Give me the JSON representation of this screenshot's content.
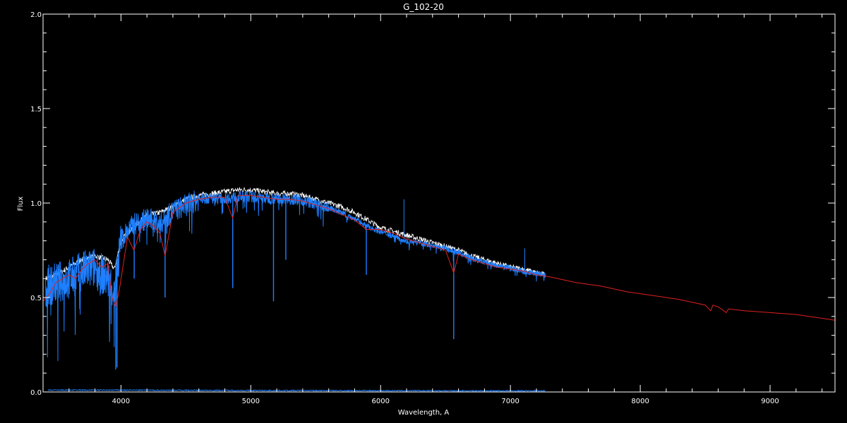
{
  "chart_data": {
    "type": "line",
    "title": "G_102-20",
    "xlabel": "Wavelength, A",
    "ylabel": "Flux",
    "xlim": [
      3400,
      9500
    ],
    "ylim": [
      0.0,
      2.0
    ],
    "x_ticks": [
      4000,
      5000,
      6000,
      7000,
      8000,
      9000
    ],
    "x_tick_labels": [
      "4000",
      "5000",
      "6000",
      "7000",
      "8000",
      "9000"
    ],
    "y_ticks": [
      0.0,
      0.5,
      1.0,
      1.5,
      2.0
    ],
    "y_tick_labels": [
      "0.0",
      "0.5",
      "1.0",
      "1.5",
      "2.0"
    ],
    "grid": false,
    "colors": {
      "background": "#000000",
      "axes": "#ffffff",
      "observed": "#1e7fff",
      "reference": "#ffffff",
      "model": "#e02020",
      "error": "#1e7fff"
    },
    "series": [
      {
        "key": "reference",
        "x": [
          3420,
          3500,
          3600,
          3700,
          3800,
          3900,
          3950,
          4000,
          4100,
          4200,
          4300,
          4400,
          4500,
          4600,
          4700,
          4800,
          4900,
          5000,
          5100,
          5200,
          5300,
          5400,
          5500,
          5600,
          5700,
          5800,
          5900,
          6000,
          6100,
          6200,
          6300,
          6400,
          6500,
          6600,
          6700,
          6800,
          6900,
          7000,
          7100,
          7200,
          7270
        ],
        "y": [
          0.6,
          0.62,
          0.66,
          0.7,
          0.72,
          0.7,
          0.65,
          0.8,
          0.88,
          0.93,
          0.95,
          0.98,
          1.02,
          1.04,
          1.05,
          1.06,
          1.07,
          1.07,
          1.06,
          1.05,
          1.05,
          1.04,
          1.02,
          1.0,
          0.98,
          0.95,
          0.91,
          0.87,
          0.85,
          0.83,
          0.81,
          0.79,
          0.77,
          0.75,
          0.72,
          0.7,
          0.68,
          0.66,
          0.65,
          0.63,
          0.62
        ]
      },
      {
        "key": "observed",
        "x": [
          3420,
          3500,
          3600,
          3700,
          3800,
          3900,
          3950,
          4000,
          4100,
          4200,
          4300,
          4400,
          4500,
          4600,
          4700,
          4800,
          4900,
          5000,
          5100,
          5200,
          5300,
          5400,
          5500,
          5600,
          5700,
          5800,
          5900,
          6000,
          6100,
          6200,
          6300,
          6400,
          6500,
          6600,
          6700,
          6800,
          6900,
          7000,
          7100,
          7200,
          7270
        ],
        "y": [
          0.58,
          0.6,
          0.62,
          0.66,
          0.68,
          0.62,
          0.55,
          0.82,
          0.9,
          0.93,
          0.9,
          0.97,
          1.0,
          1.03,
          1.03,
          1.03,
          1.04,
          1.04,
          1.03,
          1.03,
          1.03,
          1.02,
          1.0,
          0.98,
          0.95,
          0.92,
          0.88,
          0.85,
          0.83,
          0.8,
          0.79,
          0.78,
          0.76,
          0.74,
          0.71,
          0.69,
          0.67,
          0.66,
          0.64,
          0.63,
          0.62
        ],
        "lines": [
          {
            "x": 3960,
            "y": 0.12
          },
          {
            "x": 3970,
            "y": 0.13
          },
          {
            "x": 4102,
            "y": 0.6
          },
          {
            "x": 4340,
            "y": 0.5
          },
          {
            "x": 4861,
            "y": 0.55
          },
          {
            "x": 5175,
            "y": 0.48
          },
          {
            "x": 5270,
            "y": 0.7
          },
          {
            "x": 5890,
            "y": 0.62
          },
          {
            "x": 6563,
            "y": 0.28
          },
          {
            "x": 6520,
            "y": 0.75
          },
          {
            "x": 6820,
            "y": 0.7
          },
          {
            "x": 7150,
            "y": 0.62
          }
        ],
        "spikes": [
          {
            "x": 6180,
            "y": 1.02
          },
          {
            "x": 7110,
            "y": 0.76
          }
        ]
      },
      {
        "key": "model",
        "x": [
          3400,
          3450,
          3500,
          3550,
          3600,
          3650,
          3700,
          3750,
          3800,
          3850,
          3900,
          3930,
          3960,
          3990,
          4050,
          4100,
          4150,
          4200,
          4250,
          4300,
          4340,
          4400,
          4500,
          4600,
          4700,
          4800,
          4861,
          4900,
          5000,
          5100,
          5200,
          5300,
          5400,
          5500,
          5600,
          5700,
          5800,
          5890,
          6000,
          6100,
          6200,
          6300,
          6400,
          6500,
          6563,
          6600,
          6700,
          6800,
          6900,
          7000,
          7100,
          7200,
          7300,
          7500,
          7700,
          7900,
          8100,
          8300,
          8500,
          8542,
          8560,
          8600,
          8662,
          8680,
          8800,
          9000,
          9200,
          9400,
          9500
        ],
        "y": [
          0.48,
          0.52,
          0.58,
          0.6,
          0.62,
          0.6,
          0.65,
          0.68,
          0.7,
          0.66,
          0.68,
          0.5,
          0.45,
          0.55,
          0.82,
          0.75,
          0.86,
          0.9,
          0.88,
          0.84,
          0.72,
          0.95,
          1.0,
          1.02,
          1.03,
          1.03,
          0.92,
          1.04,
          1.04,
          1.03,
          1.02,
          1.02,
          1.01,
          0.99,
          0.97,
          0.94,
          0.91,
          0.86,
          0.86,
          0.84,
          0.81,
          0.79,
          0.77,
          0.75,
          0.63,
          0.73,
          0.7,
          0.68,
          0.66,
          0.65,
          0.64,
          0.62,
          0.61,
          0.58,
          0.56,
          0.53,
          0.51,
          0.49,
          0.46,
          0.43,
          0.46,
          0.45,
          0.42,
          0.44,
          0.43,
          0.42,
          0.41,
          0.39,
          0.38
        ]
      },
      {
        "key": "error",
        "x": [
          3440,
          4000,
          5000,
          6000,
          7000,
          7270
        ],
        "y": [
          0.01,
          0.01,
          0.008,
          0.007,
          0.006,
          0.006
        ]
      }
    ]
  }
}
